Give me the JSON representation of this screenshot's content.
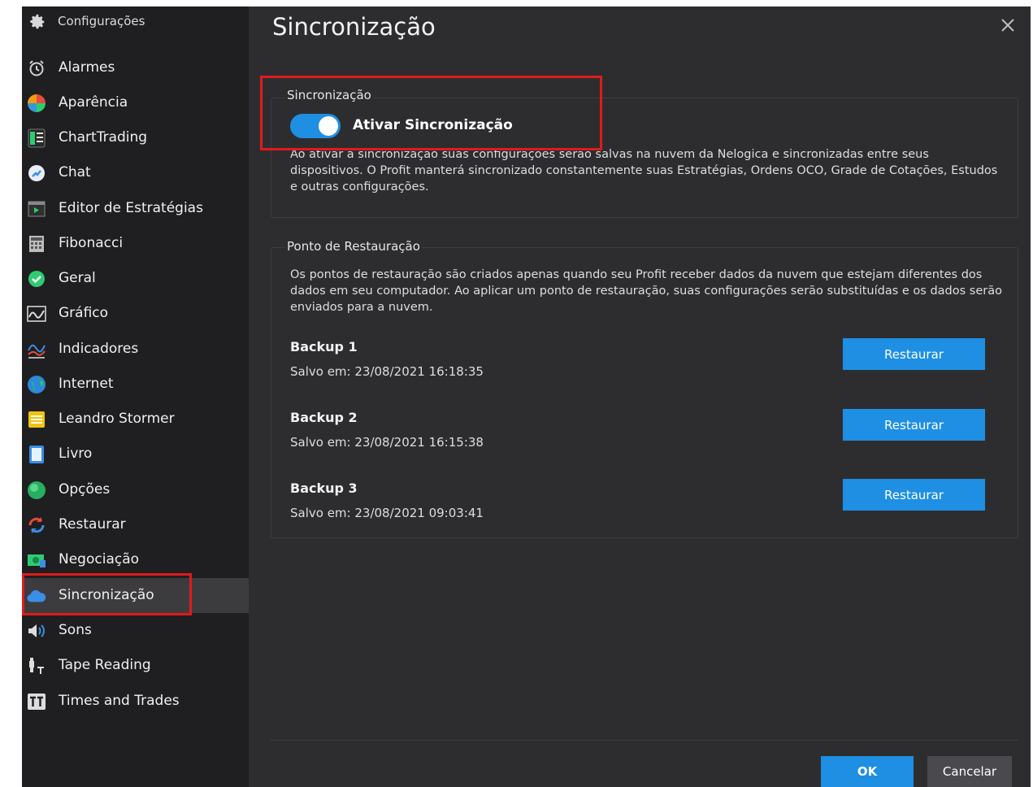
{
  "window": {
    "title": "Sincronização"
  },
  "sidebar": {
    "header": {
      "label": "Configurações",
      "icon": "gear-icon"
    },
    "items": [
      {
        "label": "Alarmes",
        "icon": "alarm-clock-icon",
        "color": "#cccccc"
      },
      {
        "label": "Aparência",
        "icon": "palette-pie-icon",
        "color": "#f39c12"
      },
      {
        "label": "ChartTrading",
        "icon": "charttrading-icon",
        "color": "#2ecc71"
      },
      {
        "label": "Chat",
        "icon": "chat-icon",
        "color": "#3a8ee6"
      },
      {
        "label": "Editor de Estratégias",
        "icon": "play-editor-icon",
        "color": "#2ecc71"
      },
      {
        "label": "Fibonacci",
        "icon": "calculator-icon",
        "color": "#bdbdbd"
      },
      {
        "label": "Geral",
        "icon": "check-circle-icon",
        "color": "#2ecc71"
      },
      {
        "label": "Gráfico",
        "icon": "chart-wave-icon",
        "color": "#dddddd"
      },
      {
        "label": "Indicadores",
        "icon": "indicator-lines-icon",
        "color": "#3a8ee6"
      },
      {
        "label": "Internet",
        "icon": "globe-icon",
        "color": "#2e86de"
      },
      {
        "label": "Leandro Stormer",
        "icon": "window-list-icon",
        "color": "#f1c40f"
      },
      {
        "label": "Livro",
        "icon": "book-icon",
        "color": "#3a8ee6"
      },
      {
        "label": "Opções",
        "icon": "green-orb-icon",
        "color": "#2ecc71"
      },
      {
        "label": "Restaurar",
        "icon": "refresh-icon",
        "color": "#e74c3c"
      },
      {
        "label": "Negociação",
        "icon": "money-icon",
        "color": "#2ecc71"
      },
      {
        "label": "Sincronização",
        "icon": "cloud-icon",
        "color": "#3a8ee6",
        "active": true
      },
      {
        "label": "Sons",
        "icon": "speaker-icon",
        "color": "#dddddd"
      },
      {
        "label": "Tape Reading",
        "icon": "tape-reading-icon",
        "color": "#dddddd"
      },
      {
        "label": "Times and Trades",
        "icon": "tt-icon",
        "color": "#dddddd"
      }
    ]
  },
  "sync_group": {
    "title": "Sincronização",
    "toggle_label": "Ativar Sincronização",
    "toggle_on": true,
    "description": "Ao ativar a sincronização suas configurações serão salvas na nuvem da Nelogica e sincronizadas entre seus dispositivos. O Profit manterá sincronizado constantemente suas Estratégias, Ordens OCO, Grade de Cotações, Estudos e outras configurações."
  },
  "restore_group": {
    "title": "Ponto de Restauração",
    "description": "Os pontos de restauração são criados apenas quando seu Profit receber dados da nuvem que estejam diferentes dos dados em seu computador. Ao aplicar um ponto de restauração, suas configurações serão substituídas e os dados serão enviados para a nuvem.",
    "backups": [
      {
        "name": "Backup 1",
        "saved": "Salvo em: 23/08/2021 16:18:35",
        "button": "Restaurar"
      },
      {
        "name": "Backup 2",
        "saved": "Salvo em: 23/08/2021 16:15:38",
        "button": "Restaurar"
      },
      {
        "name": "Backup 3",
        "saved": "Salvo em: 23/08/2021 09:03:41",
        "button": "Restaurar"
      }
    ]
  },
  "footer": {
    "ok_label": "OK",
    "cancel_label": "Cancelar"
  },
  "colors": {
    "accent": "#1e8fe3",
    "highlight": "#e01b1b",
    "background": "#2d2d30",
    "sidebar": "#1f1f21"
  }
}
